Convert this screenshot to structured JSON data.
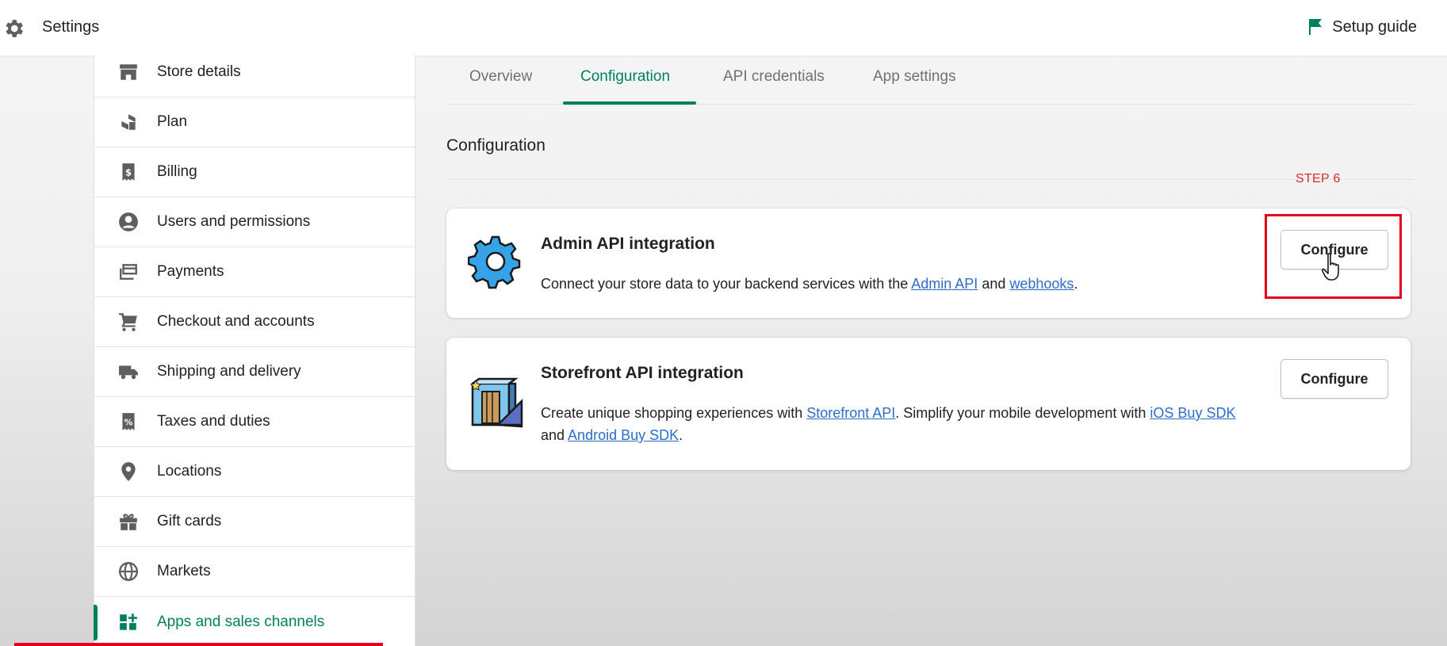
{
  "topbar": {
    "title": "Settings",
    "settings_icon": "gear-icon",
    "setup_guide_label": "Setup guide",
    "setup_guide_icon": "flag-icon"
  },
  "sidebar": {
    "items": [
      {
        "label": "Store details",
        "icon": "store-icon"
      },
      {
        "label": "Plan",
        "icon": "plan-icon"
      },
      {
        "label": "Billing",
        "icon": "billing-icon"
      },
      {
        "label": "Users and permissions",
        "icon": "user-icon"
      },
      {
        "label": "Payments",
        "icon": "payments-icon"
      },
      {
        "label": "Checkout and accounts",
        "icon": "cart-icon"
      },
      {
        "label": "Shipping and delivery",
        "icon": "truck-icon"
      },
      {
        "label": "Taxes and duties",
        "icon": "tax-icon"
      },
      {
        "label": "Locations",
        "icon": "location-pin-icon"
      },
      {
        "label": "Gift cards",
        "icon": "gift-icon"
      },
      {
        "label": "Markets",
        "icon": "globe-icon"
      },
      {
        "label": "Apps and sales channels",
        "icon": "apps-icon",
        "active": true
      }
    ]
  },
  "tabs": [
    {
      "label": "Overview"
    },
    {
      "label": "Configuration",
      "active": true
    },
    {
      "label": "API credentials"
    },
    {
      "label": "App settings"
    }
  ],
  "section": {
    "title": "Configuration"
  },
  "annotation": {
    "step_label": "STEP 6",
    "color": "#e3001b"
  },
  "cards": {
    "admin": {
      "title": "Admin API integration",
      "icon": "gear-icon",
      "desc_prefix": "Connect your store data to your backend services with the ",
      "link1": "Admin API",
      "desc_middle": " and ",
      "link2": "webhooks",
      "desc_suffix": ".",
      "button_label": "Configure"
    },
    "storefront": {
      "title": "Storefront API integration",
      "icon": "storefront-icon",
      "desc_prefix": "Create unique shopping experiences with ",
      "link1": "Storefront API",
      "desc_middle": ". Simplify your mobile development with ",
      "link2": "iOS Buy SDK",
      "desc_middle2": " and ",
      "link3": "Android Buy SDK",
      "desc_suffix": ".",
      "button_label": "Configure"
    }
  },
  "colors": {
    "accent": "#007f5f",
    "link": "#2c6ecb",
    "highlight": "#e3001b"
  }
}
